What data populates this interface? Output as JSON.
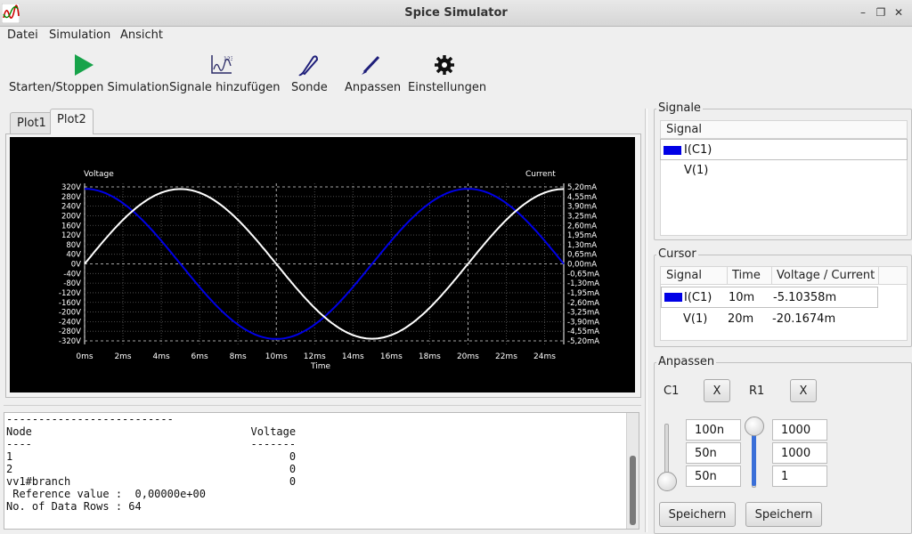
{
  "window": {
    "title": "Spice Simulator"
  },
  "menu": {
    "items": [
      "Datei",
      "Simulation",
      "Ansicht"
    ]
  },
  "toolbar": {
    "start_stop": "Starten/Stoppen Simulation",
    "add_signals": "Signale hinzufügen",
    "probe": "Sonde",
    "tune": "Anpassen",
    "settings": "Einstellungen"
  },
  "plot_tabs": [
    "Plot1",
    "Plot2"
  ],
  "chart_data": {
    "type": "line",
    "ylabel_left": "Voltage",
    "ylabel_right": "Current",
    "xlabel": "Time",
    "x_ticks": [
      "0ms",
      "2ms",
      "4ms",
      "6ms",
      "8ms",
      "10ms",
      "12ms",
      "14ms",
      "16ms",
      "18ms",
      "20ms",
      "22ms",
      "24ms"
    ],
    "y_ticks_left": [
      "320V",
      "280V",
      "240V",
      "200V",
      "160V",
      "120V",
      "80V",
      "40V",
      "0V",
      "-40V",
      "-80V",
      "-120V",
      "-160V",
      "-200V",
      "-240V",
      "-280V",
      "-320V"
    ],
    "y_ticks_right": [
      "5,20mA",
      "4,55mA",
      "3,90mA",
      "3,25mA",
      "2,60mA",
      "1,95mA",
      "1,30mA",
      "0,65mA",
      "0,00mA",
      "-0,65mA",
      "-1,30mA",
      "-1,95mA",
      "-2,60mA",
      "-3,25mA",
      "-3,90mA",
      "-4,55mA",
      "-5,20mA"
    ],
    "xlim_ms": [
      0,
      25
    ],
    "ylim_left_v": [
      -320,
      320
    ],
    "ylim_right_ma": [
      -5.2,
      5.2
    ],
    "series": [
      {
        "name": "I(C1)",
        "color": "#0000e6",
        "axis": "right",
        "amplitude": 5.07,
        "phase_deg": 90,
        "period_ms": 20
      },
      {
        "name": "V(1)",
        "color": "#ffffff",
        "axis": "left",
        "amplitude": 311,
        "phase_deg": 0,
        "period_ms": 20
      }
    ],
    "grid": true
  },
  "console": {
    "lines": [
      "--------------------------",
      "Node                                  Voltage",
      "----                                  -------",
      "1                                           0",
      "2                                           0",
      "vv1#branch                                  0",
      " Reference value :  0,00000e+00",
      "No. of Data Rows : 64"
    ]
  },
  "signals": {
    "title": "Signale",
    "header": "Signal",
    "items": [
      {
        "name": "I(C1)",
        "color": "#0000e6",
        "selected": true
      },
      {
        "name": "V(1)",
        "color": "",
        "selected": false
      }
    ]
  },
  "cursor": {
    "title": "Cursor",
    "headers": [
      "Signal",
      "Time",
      "Voltage / Current"
    ],
    "rows": [
      {
        "signal": "I(C1)",
        "time": "10m",
        "value": "-5.10358m",
        "color": "#0000e6"
      },
      {
        "signal": "V(1)",
        "time": "20m",
        "value": "-20.1674m",
        "color": ""
      }
    ]
  },
  "tuner": {
    "title": "Anpassen",
    "close_label": "X",
    "save_label": "Speichern",
    "items": [
      {
        "name": "C1",
        "max": "100n",
        "value": "50n",
        "min": "50n",
        "slider_fraction": 0.0
      },
      {
        "name": "R1",
        "max": "1000",
        "value": "1000",
        "min": "1",
        "slider_fraction": 1.0
      }
    ]
  }
}
